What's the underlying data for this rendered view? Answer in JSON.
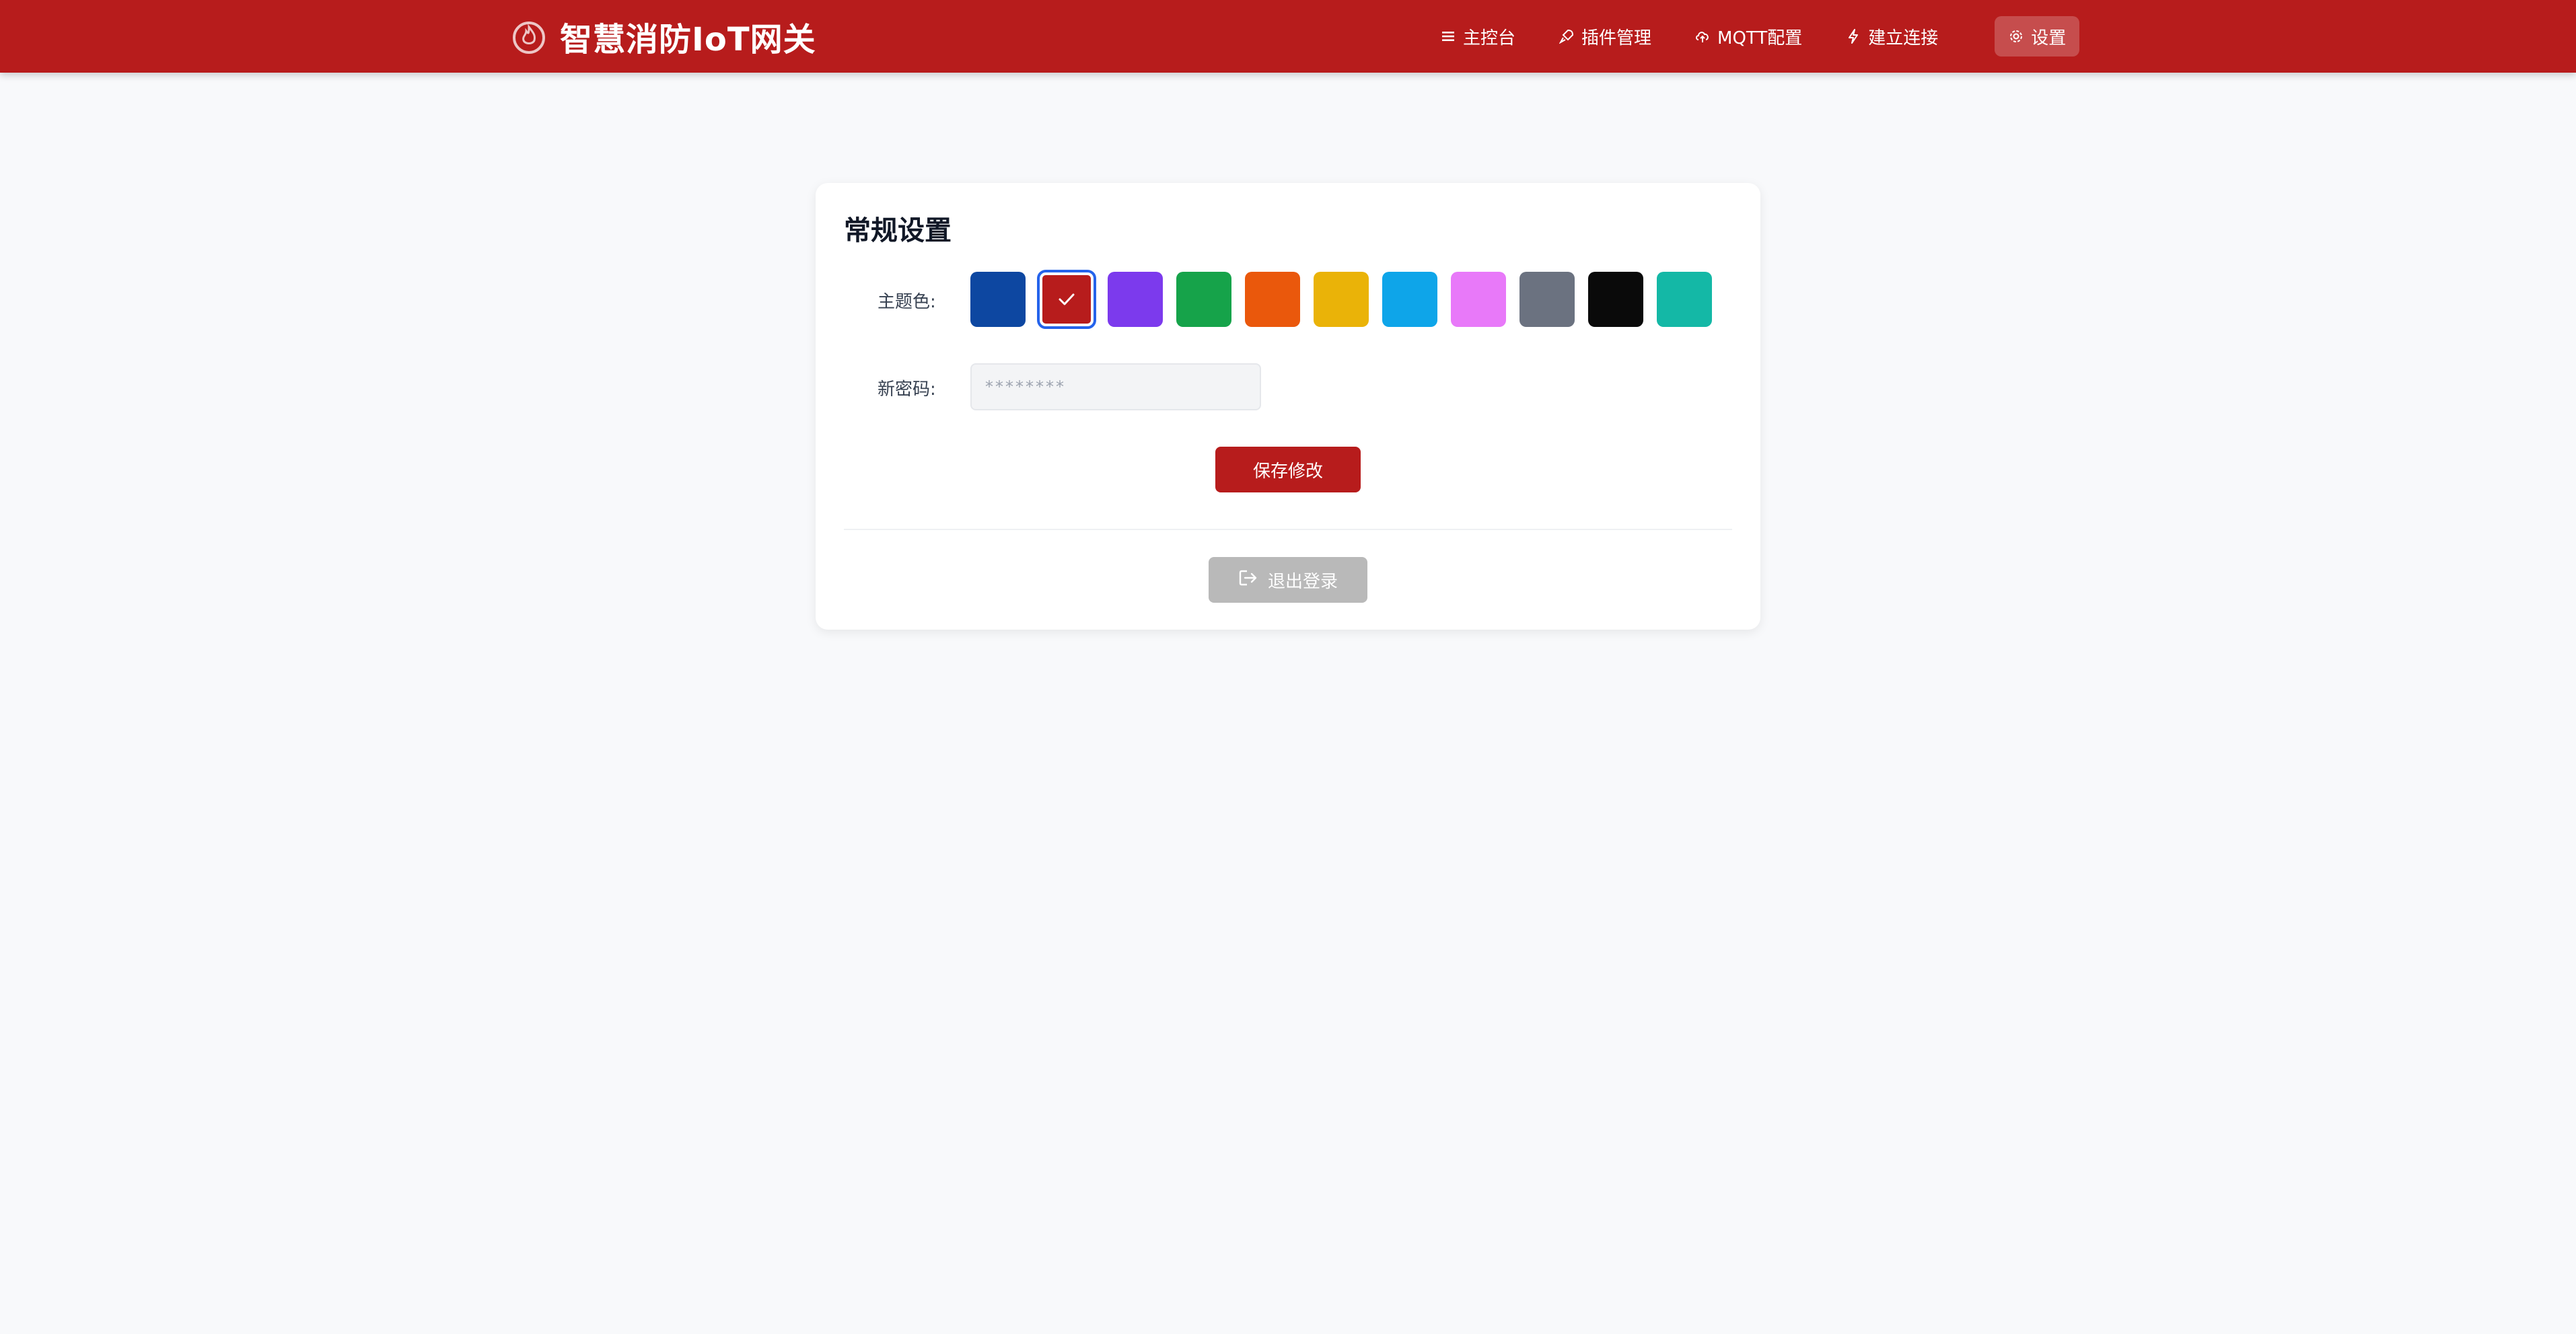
{
  "header": {
    "brand_icon": "flame-icon",
    "title": "智慧消防IoT网关",
    "background_color": "#b71c1c",
    "nav": [
      {
        "label": "主控台",
        "icon": "menu-icon"
      },
      {
        "label": "插件管理",
        "icon": "rocket-icon"
      },
      {
        "label": "MQTT配置",
        "icon": "cloud-upload-icon"
      },
      {
        "label": "建立连接",
        "icon": "bolt-icon"
      },
      {
        "label": "设置",
        "icon": "gear-icon",
        "active": true
      }
    ]
  },
  "settings": {
    "title": "常规设置",
    "theme_label": "主题色:",
    "theme_colors": [
      "#0d47a1",
      "#b71c1c",
      "#7c3aed",
      "#16a34a",
      "#ea580c",
      "#eab308",
      "#0ea5e9",
      "#e879f9",
      "#6b7280",
      "#0a0a0a",
      "#14b8a6"
    ],
    "selected_theme_color": "#b71c1c",
    "password_label": "新密码:",
    "password_placeholder": "********",
    "save_label": "保存修改",
    "logout_label": "退出登录",
    "logout_icon": "logout-icon"
  }
}
